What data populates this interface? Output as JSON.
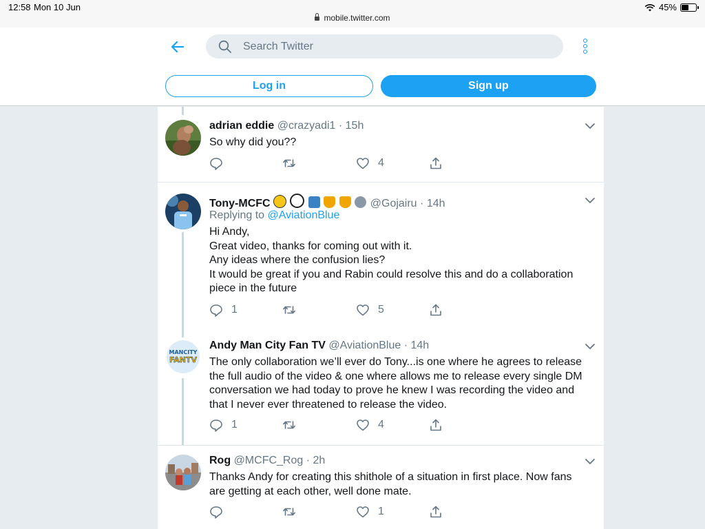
{
  "status_bar": {
    "time": "12:58",
    "date": "Mon 10 Jun",
    "url": "mobile.twitter.com",
    "battery": "45%"
  },
  "header": {
    "search_placeholder": "Search Twitter",
    "login_label": "Log in",
    "signup_label": "Sign up"
  },
  "colors": {
    "accent": "#1da1f2",
    "muted": "#657786",
    "background": "#e6ecf0"
  },
  "tweets": [
    {
      "name": "adrian eddie",
      "handle": "@crazyadi1",
      "dot": "·",
      "time": "15h",
      "body": [
        "So why did you??"
      ],
      "replies": "",
      "likes": "4"
    },
    {
      "name": "Tony-MCFC",
      "emojis": [
        "bee",
        "soccer-ball",
        "shirt",
        "trophy",
        "trophy",
        "shark"
      ],
      "handle": "@Gojairu",
      "dot": "·",
      "time": "14h",
      "reply_prefix": "Replying to",
      "reply_mention": "@AviationBlue",
      "body": [
        "Hi Andy,",
        "Great video, thanks for coming out with it.",
        "Any ideas where the confusion lies?",
        "It would be great if you and Rabin could resolve this and do a collaboration",
        "piece in the future"
      ],
      "replies": "1",
      "likes": "5"
    },
    {
      "name": "Andy Man City Fan TV",
      "handle": "@AviationBlue",
      "dot": "·",
      "time": "14h",
      "body": [
        "The only collaboration we’ll ever do Tony...is one where he agrees to release",
        "the full audio of the video & one where allows me to release every single DM",
        "conversation we had today to prove he knew I was recording the video and",
        "that I never ever threatened to release the video."
      ],
      "replies": "1",
      "likes": "4"
    },
    {
      "name": "Rog",
      "handle": "@MCFC_Rog",
      "dot": "·",
      "time": "2h",
      "body": [
        "Thanks Andy for creating this shithole of a situation in first place. Now fans",
        "are getting at each other, well done mate."
      ],
      "replies": "",
      "likes": "1"
    }
  ]
}
